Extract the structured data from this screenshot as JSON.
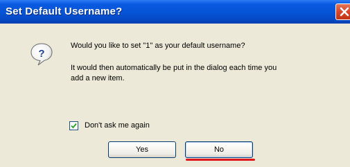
{
  "dialog": {
    "title": "Set Default Username?",
    "message_line1": "Would you like to set \"1\" as your default username?",
    "message_line2": "It would then automatically be put in the dialog each time you",
    "message_line3": "add a new item.",
    "dont_ask_label": "Don't ask me again",
    "dont_ask_checked": true,
    "yes_label": "Yes",
    "no_label": "No",
    "icon": "question-icon",
    "close_icon": "close-icon"
  },
  "colors": {
    "titlebar": "#0553d6",
    "window_background": "#ece9d8",
    "close_button": "#d7462a",
    "highlight_underline": "#e0151b"
  }
}
